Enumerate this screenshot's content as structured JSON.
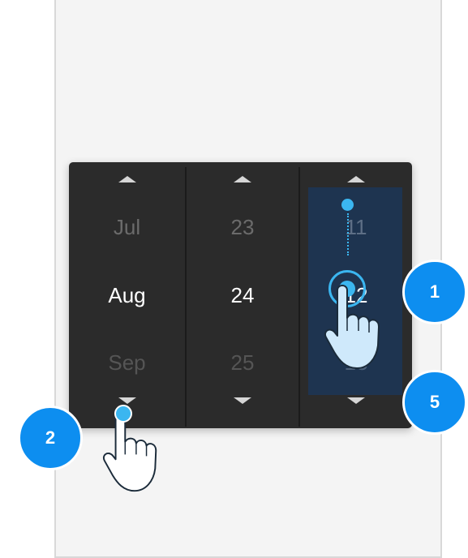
{
  "picker": {
    "month": {
      "prev": "Jul",
      "current": "Aug",
      "next": "Sep"
    },
    "day": {
      "prev": "23",
      "current": "24",
      "next": "25"
    },
    "year": {
      "prev": "11",
      "current": "12",
      "next": "13"
    }
  },
  "badges": {
    "b1": "1",
    "b2": "2",
    "b5": "5"
  },
  "colors": {
    "picker_bg": "#2b2b2b",
    "highlight": "#1e3450",
    "touch_accent": "#3bb6f0",
    "badge": "#0d8ef0"
  },
  "icons": [
    "chevron-up-icon",
    "chevron-down-icon",
    "touch-hand-icon",
    "drag-path-icon"
  ]
}
